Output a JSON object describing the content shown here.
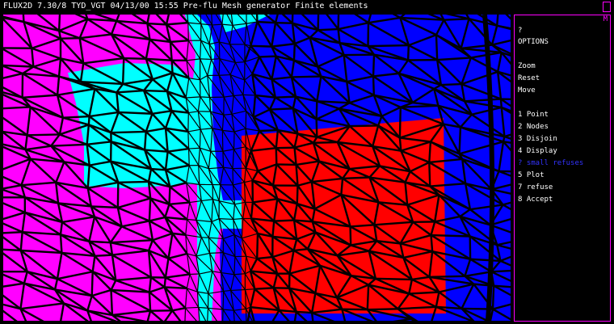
{
  "title_bar": {
    "text": "FLUX2D 7.30/8 TYD_VGT 04/13/00 15:55 Pre-flu Mesh generator Finite elements"
  },
  "menu": {
    "marker": "M",
    "prompt": "?",
    "heading": "OPTIONS",
    "view_items": [
      "Zoom",
      "Reset",
      "Move"
    ],
    "items": [
      {
        "label": "1 Point",
        "active": false
      },
      {
        "label": "2 Nodes",
        "active": false
      },
      {
        "label": "3 Disjoin",
        "active": false
      },
      {
        "label": "4 Display",
        "active": false
      },
      {
        "label": "? small refuses",
        "active": true
      },
      {
        "label": "5 Plot",
        "active": false
      },
      {
        "label": "7 refuse",
        "active": false
      },
      {
        "label": "8 Accept",
        "active": false
      }
    ]
  },
  "mesh": {
    "region_colors": {
      "magenta": "#ff00ff",
      "cyan": "#00ffff",
      "blue": "#0000ff",
      "red": "#ff0000",
      "edge": "#000000"
    }
  }
}
